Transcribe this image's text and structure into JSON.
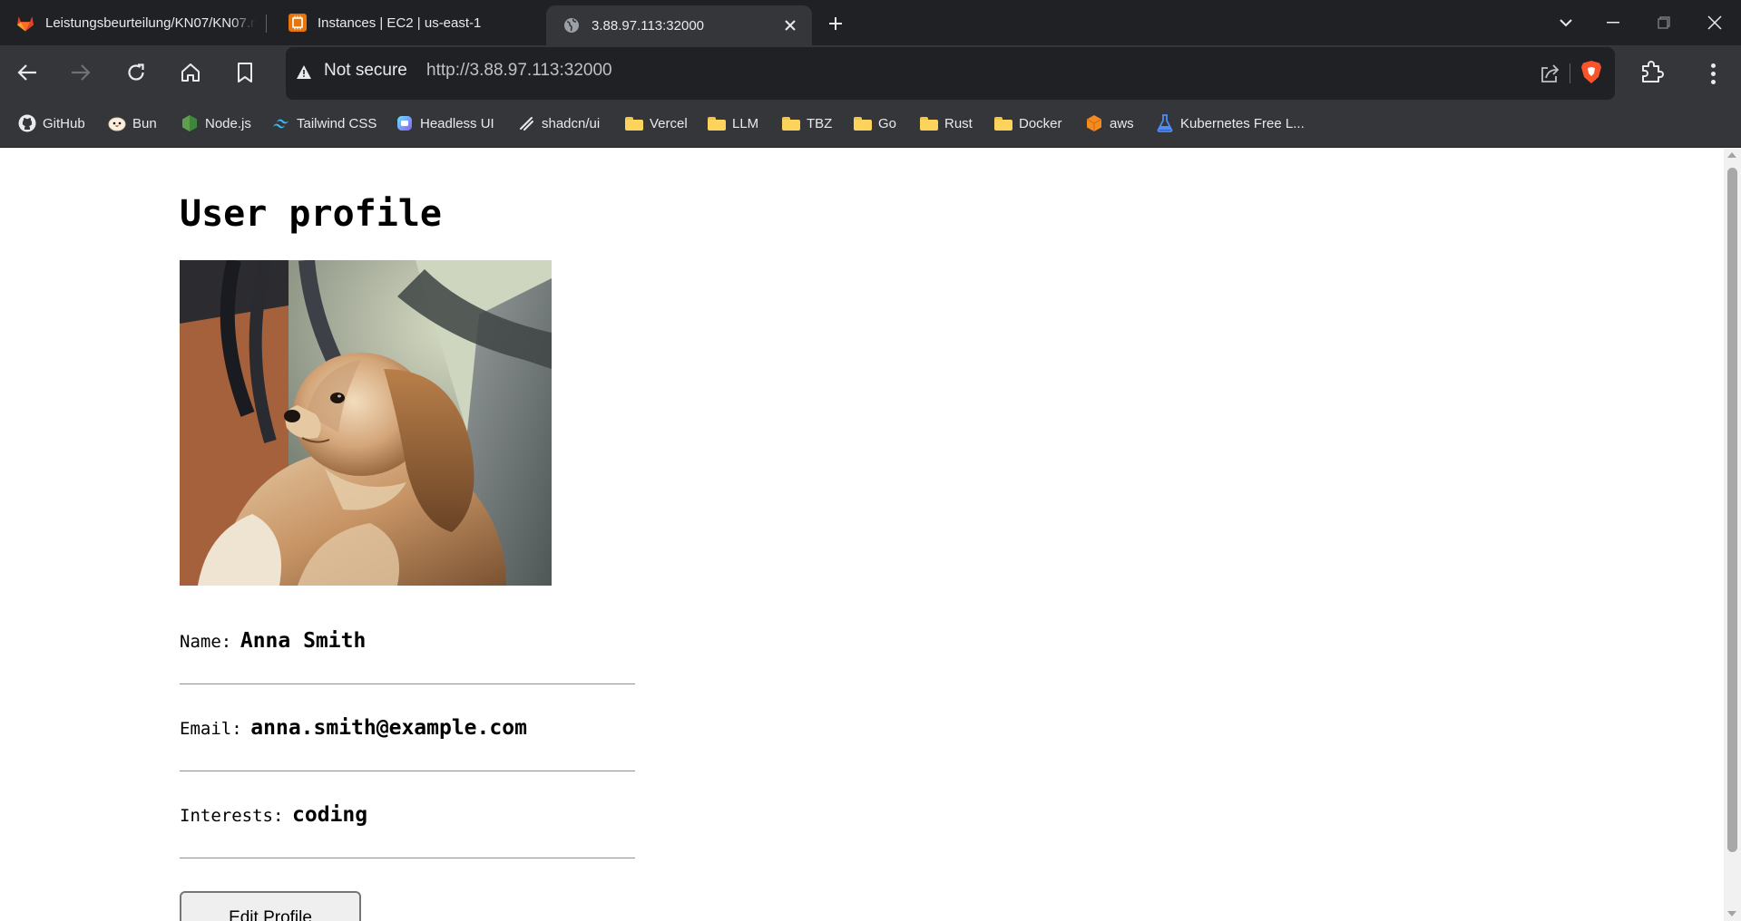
{
  "browser": {
    "tabs": [
      {
        "title": "Leistungsbeurteilung/KN07/KN07.md",
        "icon": "gitlab-icon"
      },
      {
        "title": "Instances | EC2 | us-east-1",
        "icon": "aws-ec2-icon"
      },
      {
        "title": "3.88.97.113:32000",
        "icon": "globe-icon",
        "active": true
      }
    ],
    "address": {
      "security_label": "Not secure",
      "url": "http://3.88.97.113:32000"
    },
    "bookmarks": [
      {
        "label": "GitHub",
        "icon": "github-icon"
      },
      {
        "label": "Bun",
        "icon": "bun-icon"
      },
      {
        "label": "Node.js",
        "icon": "nodejs-icon"
      },
      {
        "label": "Tailwind CSS",
        "icon": "tailwind-icon"
      },
      {
        "label": "Headless UI",
        "icon": "headlessui-icon"
      },
      {
        "label": "shadcn/ui",
        "icon": "shadcn-icon"
      },
      {
        "label": "Vercel",
        "icon": "folder-icon"
      },
      {
        "label": "LLM",
        "icon": "folder-icon"
      },
      {
        "label": "TBZ",
        "icon": "folder-icon"
      },
      {
        "label": "Go",
        "icon": "folder-icon"
      },
      {
        "label": "Rust",
        "icon": "folder-icon"
      },
      {
        "label": "Docker",
        "icon": "folder-icon"
      },
      {
        "label": "aws",
        "icon": "aws-icon"
      },
      {
        "label": "Kubernetes Free L...",
        "icon": "flask-icon"
      }
    ]
  },
  "colors": {
    "chrome_dark": "#202124",
    "chrome_toolbar": "#35363a",
    "chrome_text": "#e8eaed"
  },
  "profile": {
    "title": "User profile",
    "photo": "dog-photo",
    "fields": [
      {
        "label": "Name:",
        "value": "Anna Smith"
      },
      {
        "label": "Email:",
        "value": "anna.smith@example.com"
      },
      {
        "label": "Interests:",
        "value": "coding"
      }
    ],
    "edit_button": "Edit Profile"
  }
}
